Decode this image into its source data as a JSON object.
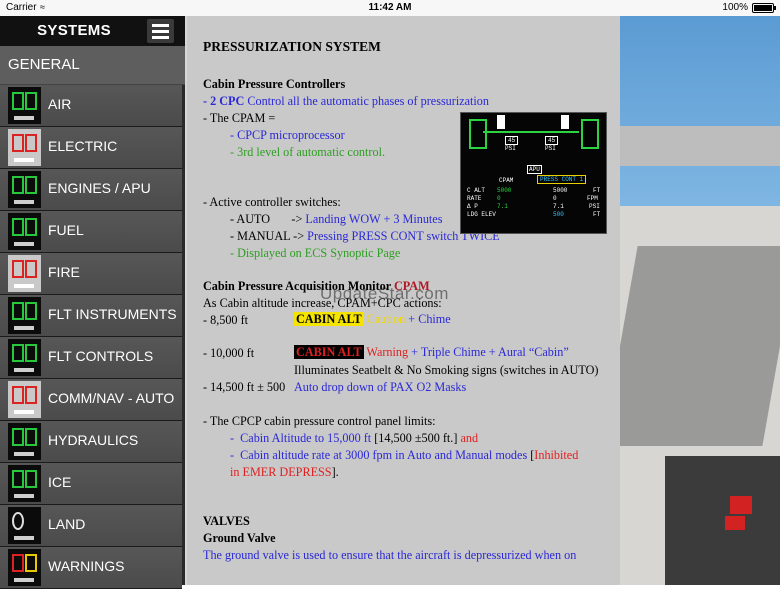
{
  "status_bar": {
    "carrier": "Carrier",
    "time": "11:42 AM",
    "battery": "100%",
    "battery_level": 1.0
  },
  "sidebar": {
    "title": "SYSTEMS",
    "general": "GENERAL",
    "items": [
      {
        "label": "AIR",
        "icon": "air-system-thumbnail"
      },
      {
        "label": "ELECTRIC",
        "icon": "electric-system-thumbnail"
      },
      {
        "label": "ENGINES / APU",
        "icon": "engines-thumbnail"
      },
      {
        "label": "FUEL",
        "icon": "fuel-thumbnail"
      },
      {
        "label": "FIRE",
        "icon": "fire-thumbnail"
      },
      {
        "label": "FLT INSTRUMENTS",
        "icon": "flt-instruments-thumbnail"
      },
      {
        "label": "FLT CONTROLS",
        "icon": "flt-controls-thumbnail"
      },
      {
        "label": "COMM/NAV - AUTO",
        "icon": "comm-nav-thumbnail"
      },
      {
        "label": "HYDRAULICS",
        "icon": "hydraulics-thumbnail"
      },
      {
        "label": "ICE",
        "icon": "ice-thumbnail"
      },
      {
        "label": "LAND",
        "icon": "land-thumbnail"
      },
      {
        "label": "WARNINGS",
        "icon": "warnings-thumbnail"
      }
    ]
  },
  "document": {
    "title": "PRESSURIZATION SYSTEM",
    "s1_heading": "Cabin Pressure Controllers",
    "s1_l1_a": "- 2 CPC",
    "s1_l1_b": " Control all the automatic phases of pressurization",
    "s1_l2": "- The CPAM =",
    "s1_l3": "- CPCP microprocessor",
    "s1_l4": "- 3rd level of automatic control.",
    "s1_l5": "- Active controller switches:",
    "s1_auto_a": "- AUTO       -> ",
    "s1_auto_b": "Landing WOW + 3 Minutes",
    "s1_manual_a": "- MANUAL -> ",
    "s1_manual_b": "Pressing PRESS CONT switch TWICE",
    "s1_l8": "- Displayed on ECS Synoptic Page",
    "s2_heading": "Cabin Pressure Acquisition Monitor ",
    "s2_heading_accent": "CPAM",
    "s2_l1": "As Cabin altitude increase, CPAM+CPC actions:",
    "s2_r1_alt": "- 8,500 ft",
    "s2_r1_tag": "CABIN ALT",
    "s2_r1_caution": " Caution",
    "s2_r1_rest": " + Chime",
    "s2_r2_alt": "- 10,000 ft",
    "s2_r2_tag": "CABIN ALT",
    "s2_r2_warning": " Warning",
    "s2_r2_rest": " + Triple Chime + Aural “Cabin”",
    "s2_r2_sub": "Illuminates Seatbelt & No Smoking signs (switches in AUTO)",
    "s2_r3_alt": "- 14,500 ft ± 500",
    "s2_r3_rest": "Auto drop down of PAX O2 Masks",
    "s3_l1": "- The CPCP cabin pressure control panel limits:",
    "s3_l2_a": "-  ",
    "s3_l2_b": "Cabin Altitude to 15,000 ft",
    "s3_l2_c": " [14,500 ±500 ft.] ",
    "s3_l2_d": "and",
    "s3_l3_a": "-  ",
    "s3_l3_b": "Cabin altitude rate at 3000 fpm in Auto and Manual modes",
    "s3_l3_c": " [",
    "s3_l3_d": "Inhibited",
    "s3_l4_a": "in EMER DEPRESS",
    "s3_l4_b": "].",
    "s4_heading": "VALVES",
    "s4_sub": "Ground Valve",
    "s4_l1": "The ground valve is used to ensure that the aircraft is depressurized when on",
    "display": {
      "left_gauge": "45",
      "right_gauge": "45",
      "gauge_unit": "PSI",
      "apu": "APU",
      "cpam": "CPAM",
      "press_cont": "PRESS CONT 1",
      "row_labels": [
        "C ALT",
        "RATE",
        "Δ P",
        "LDG ELEV"
      ],
      "cpam_values": [
        "5000",
        "0",
        "7.1",
        ""
      ],
      "cont_values": [
        "5000",
        "0",
        "7.1",
        "500"
      ],
      "units": [
        "FT",
        "FPM",
        "PSI",
        "FT"
      ]
    }
  },
  "watermark": "UpdateStar.com",
  "colors": {
    "sidebar_bg": "#2a2a2a",
    "doc_bg": "#c9c9c9",
    "text_blue": "#2a28d6",
    "text_green": "#2e9e22",
    "text_red": "#e02020"
  }
}
